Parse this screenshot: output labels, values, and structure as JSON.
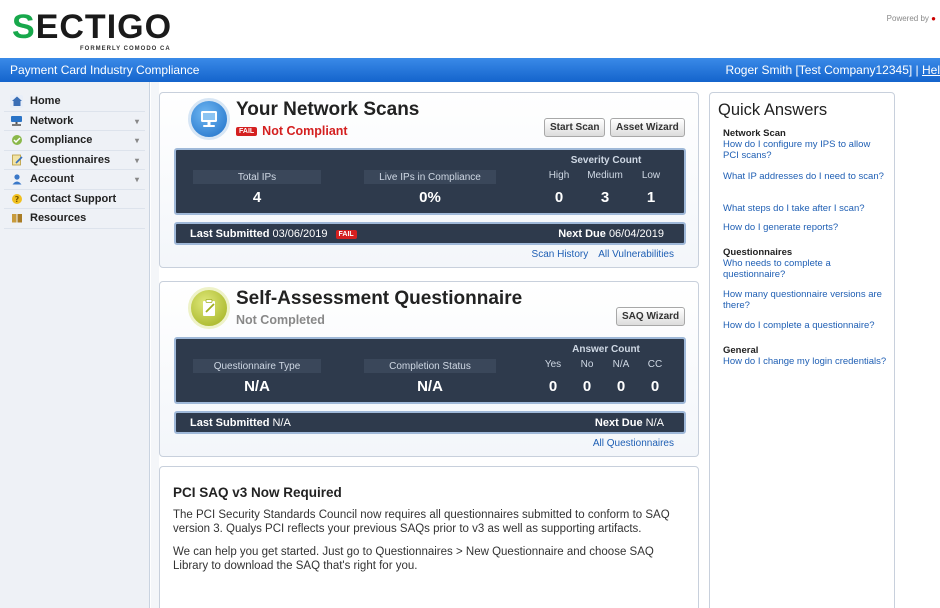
{
  "header": {
    "logo_text": "SECTIGO",
    "logo_sub": "FORMERLY COMODO CA",
    "powered_by": "Powered by"
  },
  "bluebar": {
    "title": "Payment Card Industry Compliance",
    "user": "Roger Smith [Test Company12345] | ",
    "help": "Hel"
  },
  "sidebar": {
    "items": [
      {
        "label": "Home",
        "icon": "home-icon"
      },
      {
        "label": "Network",
        "icon": "network-icon"
      },
      {
        "label": "Compliance",
        "icon": "compliance-icon"
      },
      {
        "label": "Questionnaires",
        "icon": "questionnaire-icon"
      },
      {
        "label": "Account",
        "icon": "account-icon"
      },
      {
        "label": "Contact Support",
        "icon": "support-icon"
      },
      {
        "label": "Resources",
        "icon": "resources-icon"
      }
    ]
  },
  "scans": {
    "title": "Your Network Scans",
    "fail_badge": "FAIL",
    "status": "Not Compliant",
    "start_scan": "Start Scan",
    "asset_wizard": "Asset Wizard",
    "total_ips_label": "Total IPs",
    "total_ips": "4",
    "live_ips_label": "Live IPs in Compliance",
    "live_ips": "0%",
    "severity_label": "Severity Count",
    "high_label": "High",
    "medium_label": "Medium",
    "low_label": "Low",
    "high": "0",
    "medium": "3",
    "low": "1",
    "last_submitted_label": "Last Submitted",
    "last_submitted": "03/06/2019",
    "next_due_label": "Next Due",
    "next_due": "06/04/2019",
    "scan_history": "Scan History",
    "all_vulns": "All Vulnerabilities"
  },
  "saq": {
    "title": "Self-Assessment Questionnaire",
    "status": "Not Completed",
    "saq_wizard": "SAQ Wizard",
    "type_label": "Questionnaire Type",
    "type": "N/A",
    "completion_label": "Completion Status",
    "completion": "N/A",
    "answer_label": "Answer Count",
    "yes_label": "Yes",
    "no_label": "No",
    "na_label": "N/A",
    "cc_label": "CC",
    "yes": "0",
    "no": "0",
    "na": "0",
    "cc": "0",
    "last_submitted_label": "Last Submitted",
    "last_submitted": "N/A",
    "next_due_label": "Next Due",
    "next_due": "N/A",
    "all_questionnaires": "All Questionnaires"
  },
  "news": {
    "title": "PCI SAQ v3 Now Required",
    "p1": "The PCI Security Standards Council now requires all questionnaires submitted to conform to SAQ version 3. Qualys PCI reflects your previous SAQs prior to v3 as well as supporting artifacts.",
    "p2": "We can help you get started. Just go to Questionnaires > New Questionnaire and choose SAQ Library to download the SAQ that's right for you."
  },
  "quick": {
    "title": "Quick Answers",
    "sec1": "Network Scan",
    "l1": "How do I configure my IPS to allow PCI scans?",
    "l2": "What IP addresses do I need to scan?",
    "l3": "What steps do I take after I scan?",
    "l4": "How do I generate reports?",
    "sec2": "Questionnaires",
    "l5": "Who needs to complete a questionnaire?",
    "l6": "How many questionnaire versions are there?",
    "l7": "How do I complete a questionnaire?",
    "sec3": "General",
    "l8": "How do I change my login credentials?"
  },
  "colors": {
    "brand_green": "#17a84b",
    "bluebar": "#1464cc",
    "fail_red": "#d42020",
    "stats_bg": "#2e3a4c",
    "link": "#1f5fb4"
  }
}
